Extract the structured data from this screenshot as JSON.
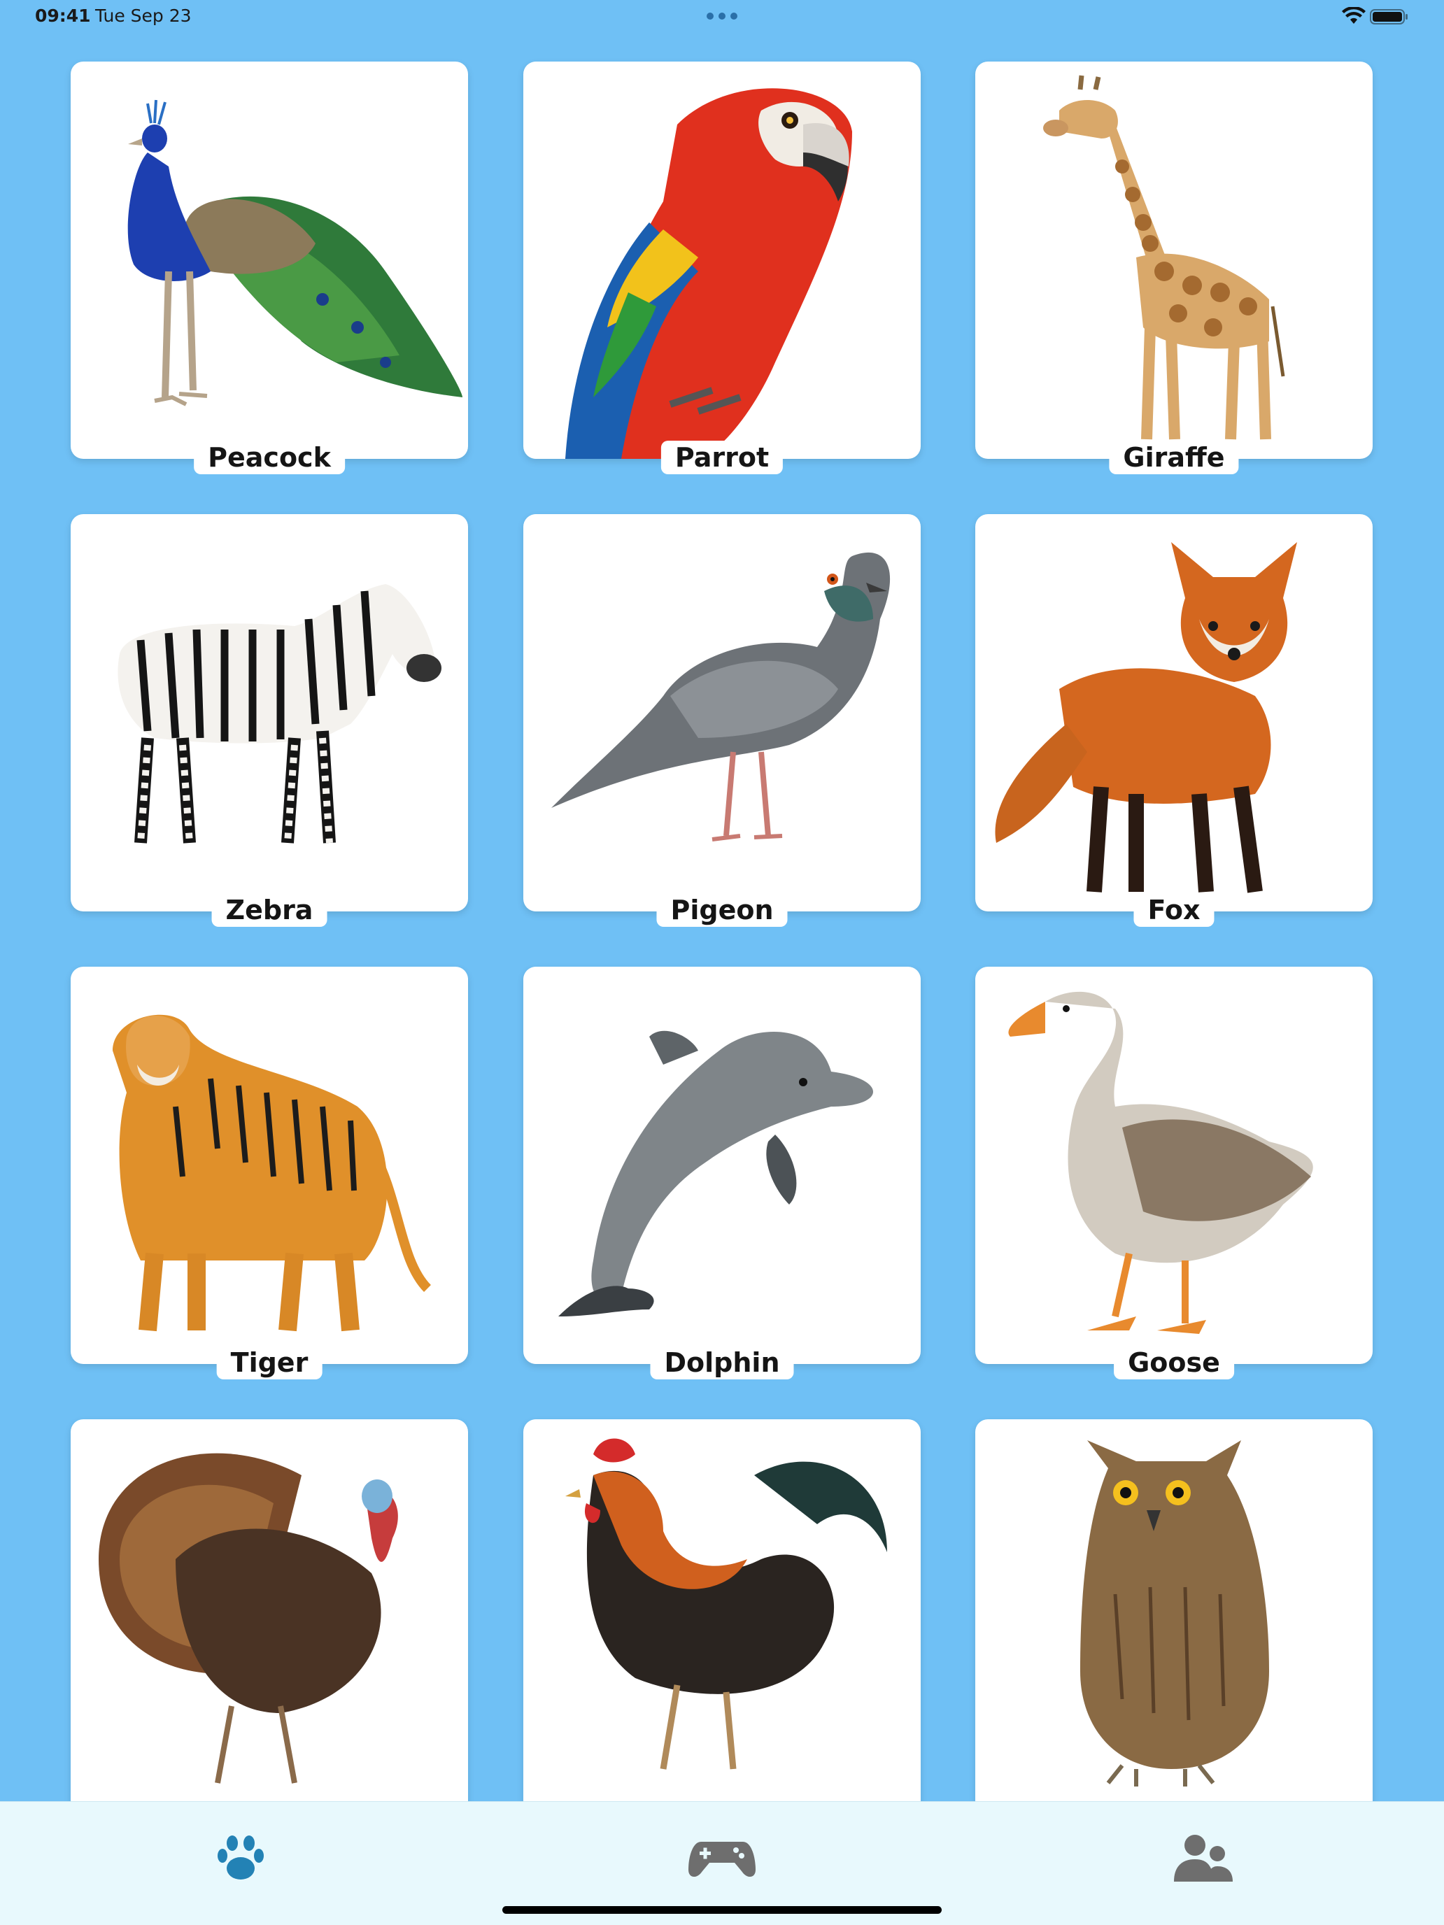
{
  "status_bar": {
    "time": "09:41",
    "date": "Tue Sep 23"
  },
  "animals": [
    {
      "id": "peacock",
      "label": "Peacock"
    },
    {
      "id": "parrot",
      "label": "Parrot"
    },
    {
      "id": "giraffe",
      "label": "Giraffe"
    },
    {
      "id": "zebra",
      "label": "Zebra"
    },
    {
      "id": "pigeon",
      "label": "Pigeon"
    },
    {
      "id": "fox",
      "label": "Fox"
    },
    {
      "id": "tiger",
      "label": "Tiger"
    },
    {
      "id": "dolphin",
      "label": "Dolphin"
    },
    {
      "id": "goose",
      "label": "Goose"
    },
    {
      "id": "turkey",
      "label": ""
    },
    {
      "id": "rooster",
      "label": ""
    },
    {
      "id": "owl",
      "label": ""
    }
  ],
  "tab_bar": {
    "tabs": [
      {
        "icon": "paw-icon",
        "selected": true
      },
      {
        "icon": "gamepad-icon",
        "selected": false
      },
      {
        "icon": "users-icon",
        "selected": false
      }
    ],
    "selected_color": "#2382b5",
    "unselected_color": "#6e6e6e"
  },
  "colors": {
    "background": "#6fc0f5",
    "card": "#ffffff",
    "tab_bar": "#e8f9fd"
  }
}
